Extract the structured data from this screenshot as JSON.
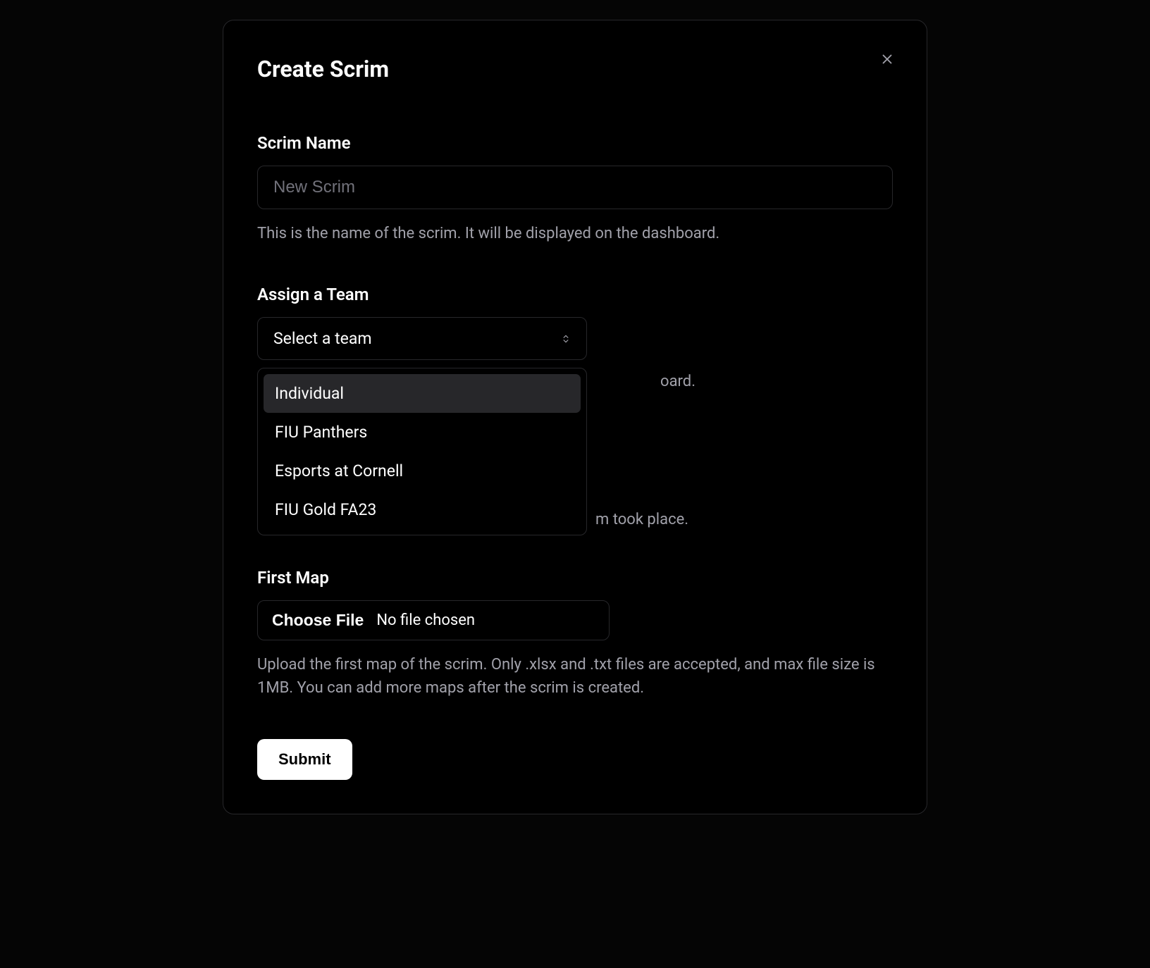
{
  "modal": {
    "title": "Create Scrim"
  },
  "scrim_name": {
    "label": "Scrim Name",
    "placeholder": "New Scrim",
    "help": "This is the name of the scrim. It will be displayed on the dashboard."
  },
  "team": {
    "label": "Assign a Team",
    "select_placeholder": "Select a team",
    "options": [
      "Individual",
      "FIU Panthers",
      "Esports at Cornell",
      "FIU Gold FA23"
    ],
    "help_visible_partial": "oard."
  },
  "date": {
    "help_visible_partial": "m took place."
  },
  "first_map": {
    "label": "First Map",
    "choose_label": "Choose File",
    "status": "No file chosen",
    "help": "Upload the first map of the scrim. Only .xlsx and .txt files are accepted, and max file size is 1MB. You can add more maps after the scrim is created."
  },
  "submit": {
    "label": "Submit"
  }
}
